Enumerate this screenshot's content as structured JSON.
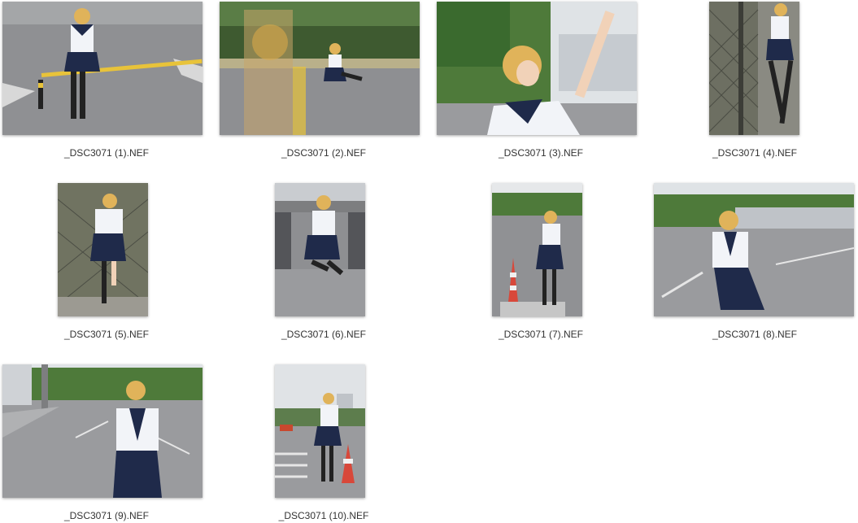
{
  "files": [
    {
      "name": "_DSC3071 (1).NEF",
      "orientation": "landscape",
      "scene": "road-barrier"
    },
    {
      "name": "_DSC3071 (2).NEF",
      "orientation": "landscape",
      "scene": "road-sitting"
    },
    {
      "name": "_DSC3071 (3).NEF",
      "orientation": "landscape",
      "scene": "reaching-trees"
    },
    {
      "name": "_DSC3071 (4).NEF",
      "orientation": "portrait",
      "scene": "fence"
    },
    {
      "name": "_DSC3071 (5).NEF",
      "orientation": "portrait",
      "scene": "fence"
    },
    {
      "name": "_DSC3071 (6).NEF",
      "orientation": "portrait",
      "scene": "jumping"
    },
    {
      "name": "_DSC3071 (7).NEF",
      "orientation": "portrait",
      "scene": "road-cone"
    },
    {
      "name": "_DSC3071 (8).NEF",
      "orientation": "landscape",
      "scene": "road"
    },
    {
      "name": "_DSC3071 (9).NEF",
      "orientation": "landscape",
      "scene": "road"
    },
    {
      "name": "_DSC3071 (10).NEF",
      "orientation": "portrait",
      "scene": "road-cone"
    }
  ],
  "colors": {
    "background": "#ffffff",
    "caption": "#333333",
    "uniform_navy": "#1f2a4a",
    "uniform_white": "#f2f4f8",
    "hair": "#e0b35a",
    "asphalt": "#8e8f92",
    "foliage": "#4e7a3a",
    "sky": "#dfe3e6"
  }
}
